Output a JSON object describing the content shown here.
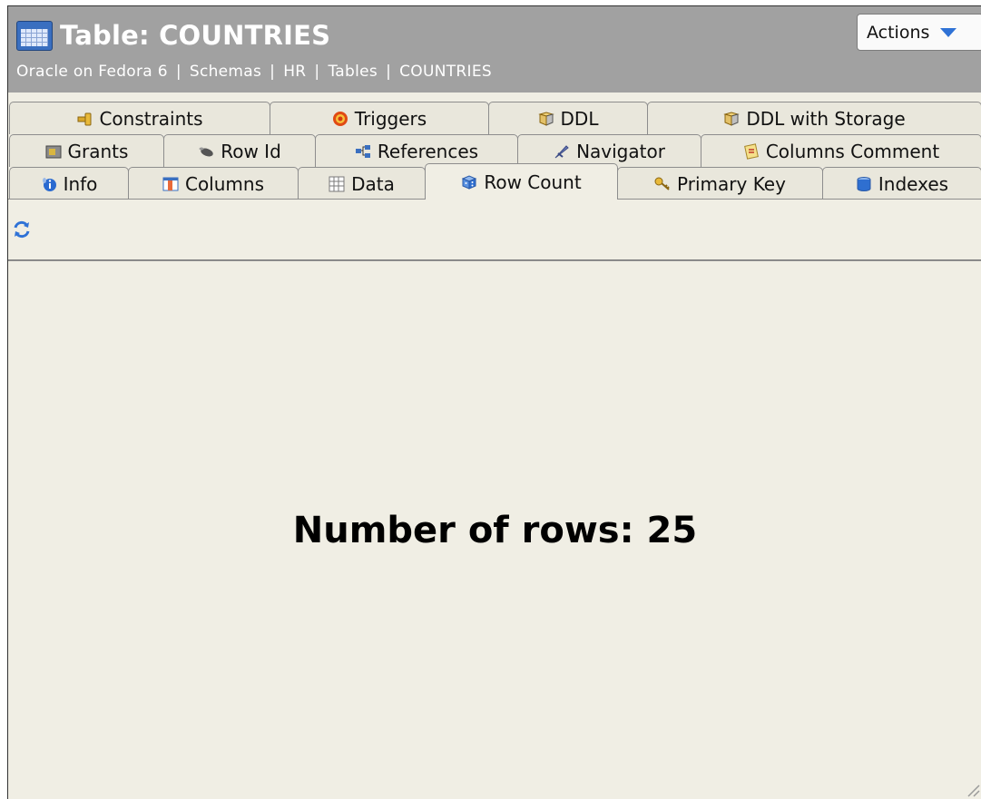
{
  "header": {
    "title": "Table: COUNTRIES",
    "breadcrumb": [
      "Oracle on Fedora 6",
      "Schemas",
      "HR",
      "Tables",
      "COUNTRIES"
    ],
    "actions_label": "Actions"
  },
  "tabs": {
    "row1": [
      {
        "label": "Constraints",
        "icon": "constraints-icon"
      },
      {
        "label": "Triggers",
        "icon": "triggers-icon"
      },
      {
        "label": "DDL",
        "icon": "ddl-icon"
      },
      {
        "label": "DDL with Storage",
        "icon": "ddl-storage-icon"
      }
    ],
    "row2": [
      {
        "label": "Grants",
        "icon": "grants-icon"
      },
      {
        "label": "Row Id",
        "icon": "row-id-icon"
      },
      {
        "label": "References",
        "icon": "references-icon"
      },
      {
        "label": "Navigator",
        "icon": "navigator-icon"
      },
      {
        "label": "Columns Comment",
        "icon": "columns-comment-icon"
      }
    ],
    "row3": [
      {
        "label": "Info",
        "icon": "info-icon"
      },
      {
        "label": "Columns",
        "icon": "columns-icon"
      },
      {
        "label": "Data",
        "icon": "data-grid-icon"
      },
      {
        "label": "Row Count",
        "icon": "row-count-icon",
        "active": true
      },
      {
        "label": "Primary Key",
        "icon": "primary-key-icon"
      },
      {
        "label": "Indexes",
        "icon": "indexes-icon"
      }
    ]
  },
  "toolbar": {
    "refresh_icon": "refresh-icon"
  },
  "content": {
    "row_count_text": "Number of rows: 25"
  },
  "colors": {
    "header_bg": "#a1a1a1",
    "content_bg": "#f0eee4",
    "accent": "#2f72d6"
  }
}
